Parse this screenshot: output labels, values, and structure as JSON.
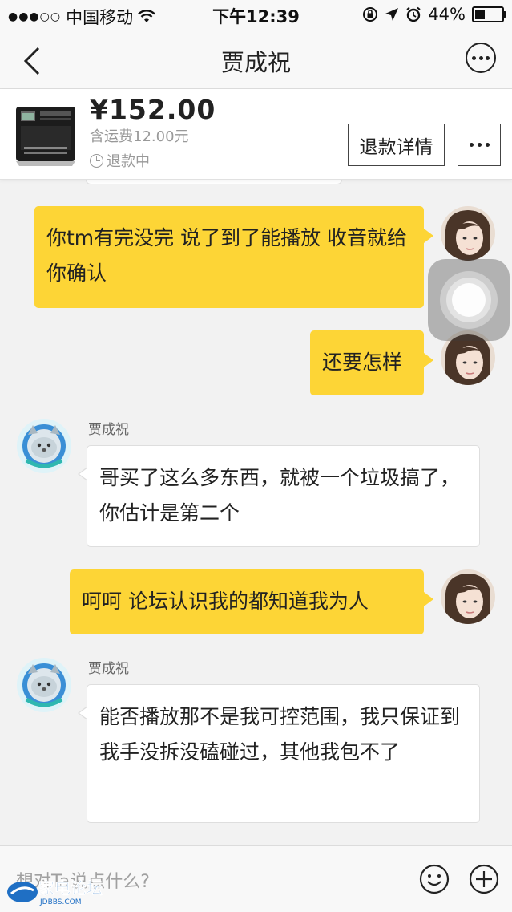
{
  "status_bar": {
    "signal": "●●●○○",
    "carrier": "中国移动",
    "time": "下午12:39",
    "battery": "44%",
    "battery_level": 0.44
  },
  "nav": {
    "title": "贾成祝",
    "back_icon": "chevron-left-icon",
    "more_icon": "more-circle-icon"
  },
  "product": {
    "price": "¥152.00",
    "shipping": "含运费12.00元",
    "status": "退款中",
    "refund_button": "退款详情"
  },
  "messages": [
    {
      "from": "me",
      "text": "你tm有完没完 说了到了能播放 收音就给你确认"
    },
    {
      "from": "me",
      "text": "还要怎样"
    },
    {
      "from": "other",
      "sender": "贾成祝",
      "text": "哥买了这么多东西，就被一个垃圾搞了，你估计是第二个"
    },
    {
      "from": "me",
      "text": "呵呵 论坛认识我的都知道我为人"
    },
    {
      "from": "other",
      "sender": "贾成祝",
      "text": "能否播放那不是我可控范围，我只保证到我手没拆没磕碰过，其他我包不了"
    }
  ],
  "input": {
    "placeholder": "想对Ta说点什么?"
  },
  "watermark": {
    "name": "家电论坛",
    "url": "JDBBS.COM"
  },
  "colors": {
    "my_bubble": "#fdd536",
    "background": "#f2f2f2"
  }
}
